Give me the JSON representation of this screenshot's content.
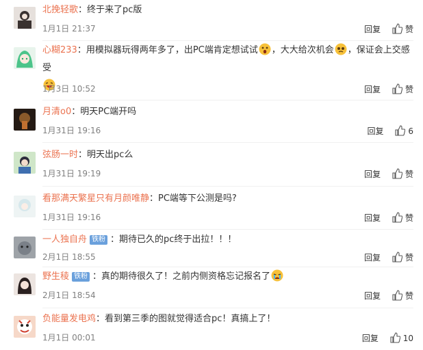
{
  "comments": [
    {
      "user": "北挽轻歌",
      "badge": "",
      "text": "：终于来了pc版",
      "emoji_end": [],
      "time": "1月1日 21:37",
      "reply": "回复",
      "likes": "赞"
    },
    {
      "user": "心糊233",
      "badge": "",
      "text": "：用模拟器玩得两年多了，出PC端肯定想试试",
      "text2": "大大给次机会",
      "text3": "，保证会上交感受",
      "time": "1月3日 10:52",
      "reply": "回复",
      "likes": "赞"
    },
    {
      "user": "月清o0",
      "badge": "",
      "text": "：明天PC端开吗",
      "time": "1月31日 19:16",
      "reply": "回复",
      "likes": "6"
    },
    {
      "user": "弦肠一时",
      "badge": "",
      "text": "：明天出pc么",
      "time": "1月31日 19:19",
      "reply": "回复",
      "likes": "赞"
    },
    {
      "user": "看那满天繁星只有月颜唯静",
      "badge": "",
      "text": "：PC端等下公测是吗?",
      "time": "1月31日 19:16",
      "reply": "回复",
      "likes": "赞"
    },
    {
      "user": "一人独自舟",
      "badge": "铁粉",
      "text": "：期待已久的pc终于出拉！！！",
      "time": "2月1日 18:55",
      "reply": "回复",
      "likes": "赞"
    },
    {
      "user": "野生稜",
      "badge": "铁粉",
      "text": "：真的期待很久了！之前内侧资格忘记报名了",
      "time": "2月1日 18:54",
      "reply": "回复",
      "likes": "赞"
    },
    {
      "user": "负能量发电鸡",
      "badge": "",
      "text": "：看到第三季的图就觉得适合pc！真搞上了！",
      "time": "1月1日 00:01",
      "reply": "回复",
      "likes": "10"
    }
  ],
  "colors": {
    "username": "#eb7350",
    "meta": "#808080",
    "badge": "#6aa0dc"
  }
}
